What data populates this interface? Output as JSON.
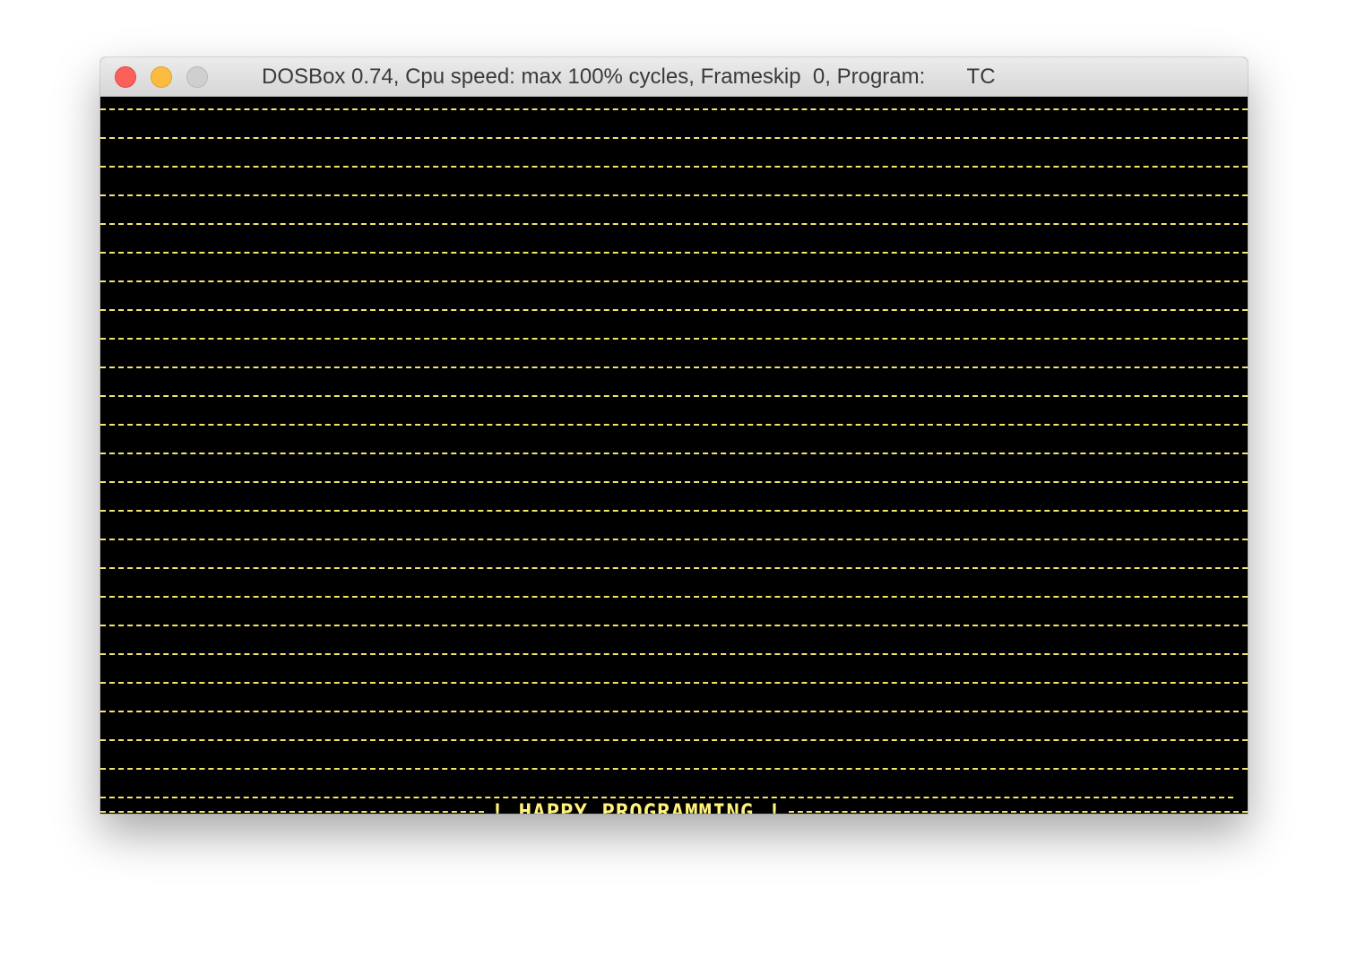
{
  "window": {
    "title": "DOSBox 0.74, Cpu speed: max 100% cycles, Frameskip  0, Program:       TC"
  },
  "screen": {
    "banner_text": "! HAPPY PROGRAMMING !",
    "text_color": "#fff27a",
    "background_color": "#000000"
  }
}
